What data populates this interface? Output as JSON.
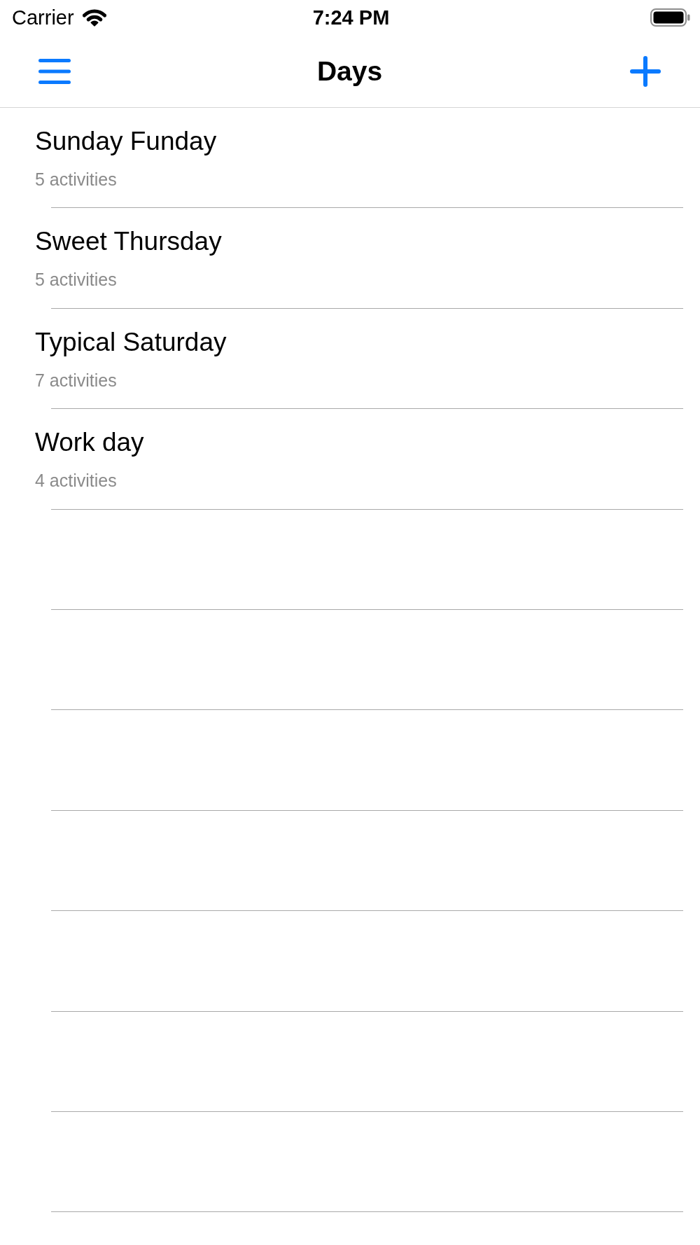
{
  "status_bar": {
    "carrier": "Carrier",
    "time": "7:24 PM"
  },
  "nav_bar": {
    "title": "Days"
  },
  "days": [
    {
      "name": "Sunday Funday",
      "detail": "5 activities"
    },
    {
      "name": "Sweet Thursday",
      "detail": "5 activities"
    },
    {
      "name": "Typical Saturday",
      "detail": "7 activities"
    },
    {
      "name": "Work day",
      "detail": "4 activities"
    }
  ]
}
